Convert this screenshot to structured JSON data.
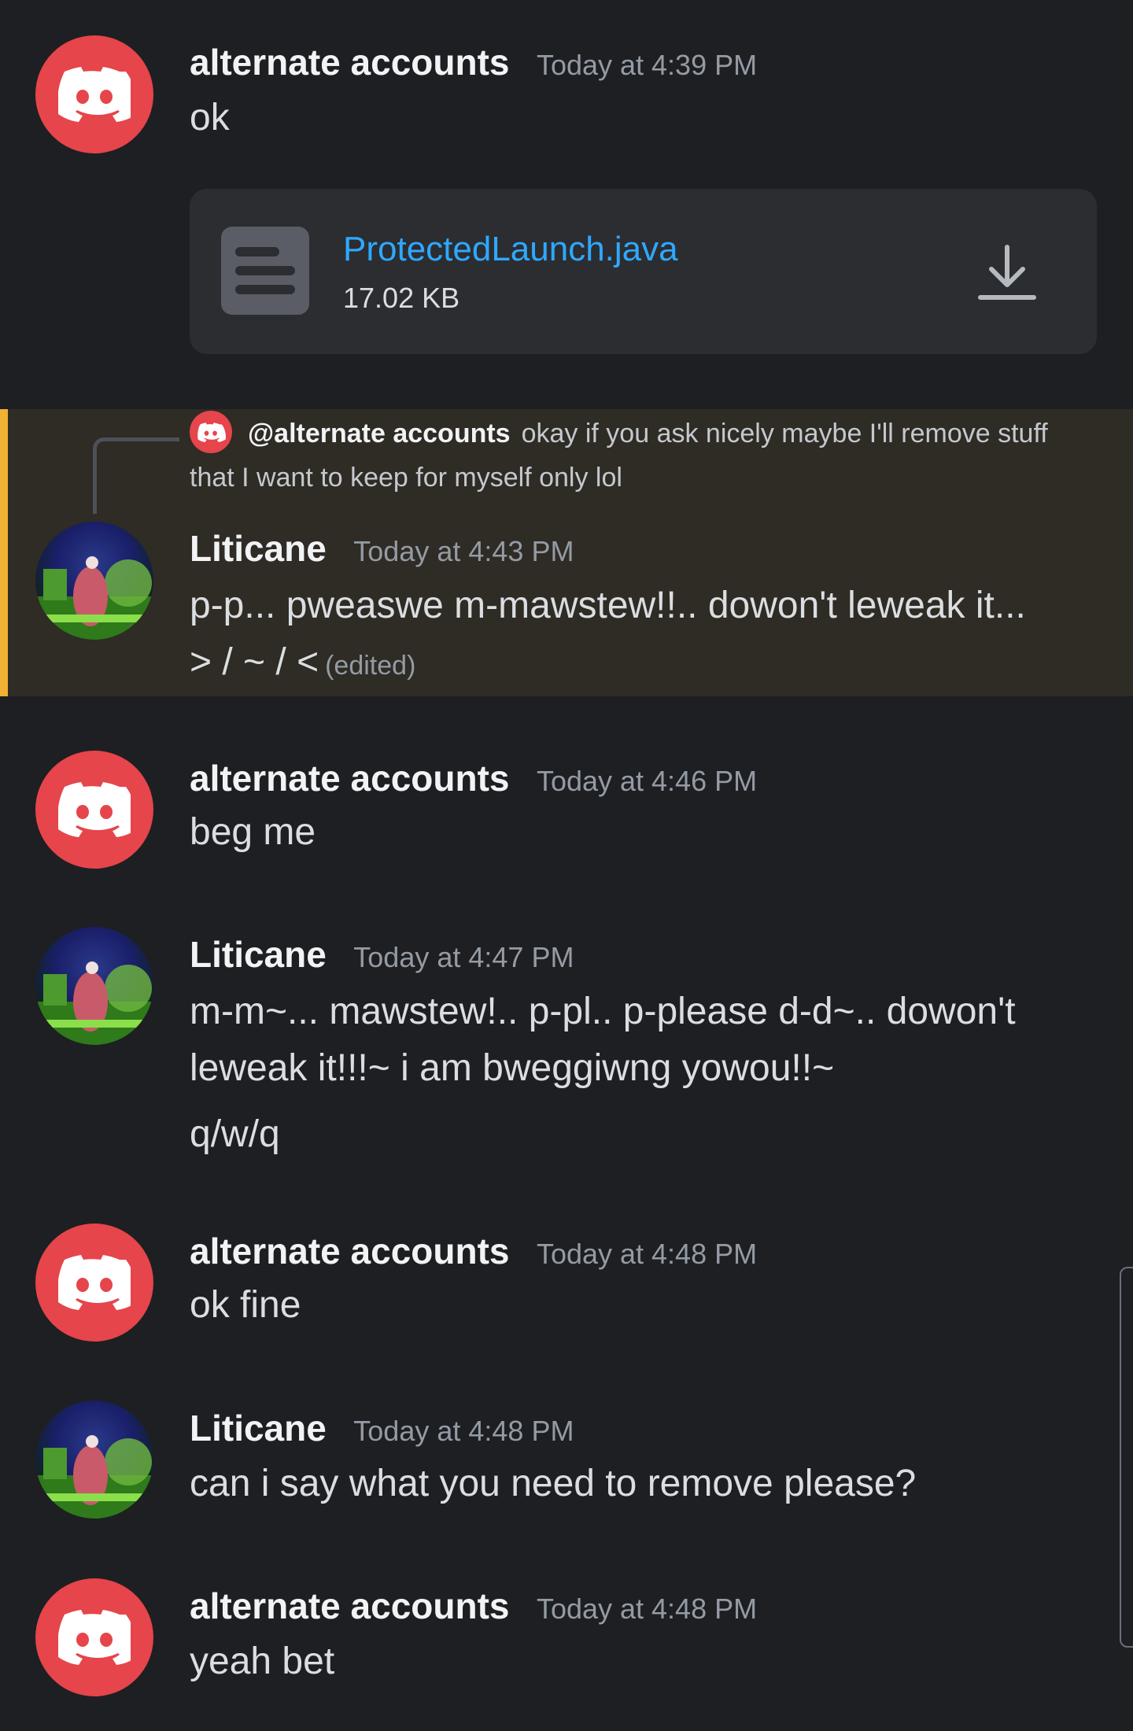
{
  "messages": [
    {
      "author": "alternate accounts",
      "time": "Today at 4:39 PM",
      "text": "ok"
    },
    {
      "author": "Liticane",
      "time": "Today at 4:43 PM",
      "text": "p-p... pweaswe m-mawstew!!.. dowon't leweak it...",
      "text2": "> / ~ / <",
      "edited": "(edited)"
    },
    {
      "author": "alternate accounts",
      "time": "Today at 4:46 PM",
      "text": "beg me"
    },
    {
      "author": "Liticane",
      "time": "Today at 4:47 PM",
      "text": "m-m~... mawstew!.. p-pl.. p-please d-d~.. dowon't",
      "text2": "leweak it!!!~ i am bweggiwng yowou!!~",
      "text3": "q/w/q"
    },
    {
      "author": "alternate accounts",
      "time": "Today at 4:48 PM",
      "text": "ok fine"
    },
    {
      "author": "Liticane",
      "time": "Today at 4:48 PM",
      "text": "can i say what you need to remove please?"
    },
    {
      "author": "alternate accounts",
      "time": "Today at 4:48 PM",
      "text": "yeah bet"
    }
  ],
  "attachment": {
    "filename": "ProtectedLaunch.java",
    "size": "17.02 KB",
    "icon": "document-icon",
    "action_icon": "download-icon"
  },
  "reply": {
    "mention": "@alternate accounts",
    "text": "okay if you ask nicely maybe I'll remove stuff that I want to keep for myself only lol"
  },
  "colors": {
    "background": "#1e1f22",
    "discord_red": "#e5454b",
    "link": "#2fa8ff",
    "highlight_bar": "#f0b232",
    "highlight_bg": "#2f2b25"
  }
}
